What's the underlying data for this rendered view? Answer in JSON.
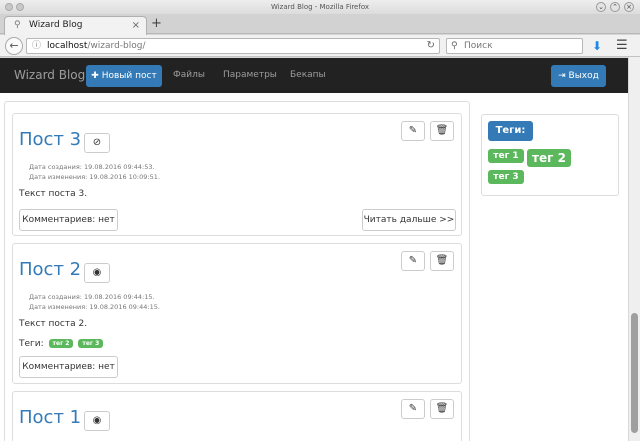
{
  "window": {
    "title": "Wizard Blog - Mozilla Firefox"
  },
  "tab": {
    "label": "Wizard Blog"
  },
  "urlbar": {
    "host": "localhost",
    "path": "/wizard-blog/"
  },
  "search": {
    "placeholder": "Поиск"
  },
  "site": {
    "brand": "Wizard Blog",
    "new_post": "Новый пост",
    "nav": [
      "Файлы",
      "Параметры",
      "Бекапы"
    ],
    "logout": "Выход"
  },
  "posts": [
    {
      "title": "Пост 3",
      "created": "Дата создания: 19.08.2016 09:44:53.",
      "modified": "Дата изменения: 19.08.2016 10:09:51.",
      "text": "Текст поста 3.",
      "comments": "Комментариев: нет",
      "read_more": "Читать дальше >>"
    },
    {
      "title": "Пост 2",
      "created": "Дата создания: 19.08.2016 09:44:15.",
      "modified": "Дата изменения: 19.08.2016 09:44:15.",
      "text": "Текст поста 2.",
      "tags_label": "Теги:",
      "tags": [
        "тег 2",
        "тег 3"
      ],
      "comments": "Комментариев: нет"
    },
    {
      "title": "Пост 1"
    }
  ],
  "sidebar": {
    "header": "Теги:",
    "tags": [
      "тег 1",
      "тег 2",
      "тег 3"
    ]
  },
  "colors": {
    "primary": "#337ab7",
    "success": "#5cb85c",
    "navbar": "#222222"
  }
}
